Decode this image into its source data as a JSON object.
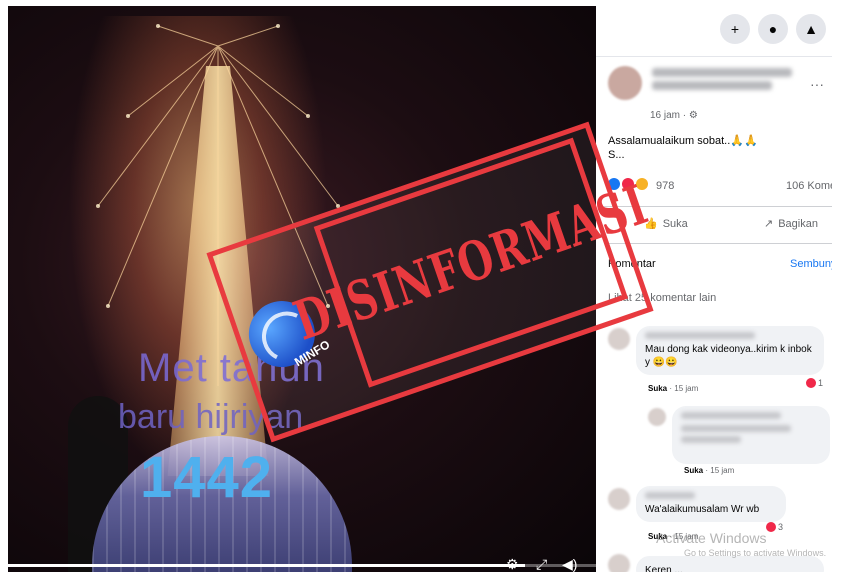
{
  "video": {
    "line1": "Met tahun",
    "line2": "baru hijriyan",
    "line3": "1442",
    "progress": 0.88
  },
  "stamp": {
    "label": "DISINFORMASI",
    "logo_text": "MINFO",
    "color": "#e83a3f"
  },
  "topbar": {
    "icons": [
      "plus-icon",
      "messenger-icon",
      "bell-icon"
    ],
    "glyphs": [
      "+",
      "●",
      "▲"
    ]
  },
  "post": {
    "time": "16 jam · ⚙",
    "text_line1": "Assalamualaikum sobat..🙏🙏",
    "text_line2": "S...",
    "reaction_count": "978",
    "comment_count": "106 Kome",
    "like_label": "Suka",
    "share_label": "Bagikan"
  },
  "comments_section": {
    "label": "Komentar",
    "link": "Sembunyi",
    "more": "Lihat 25 komentar lain"
  },
  "comments": [
    {
      "text": "Mau dong kak videonya..kirim k inbok y 😀😀",
      "meta_like": "Suka",
      "meta_time": "· 15 jam",
      "reacts": "1"
    },
    {
      "text": "",
      "meta_like": "Suka",
      "meta_time": "· 15 jam",
      "reacts": ""
    },
    {
      "text": "Wa'alaikumusalam Wr wb",
      "meta_like": "Suka",
      "meta_time": "· 15 jam",
      "reacts": "3"
    },
    {
      "text": "Keren ...",
      "meta_like": "",
      "meta_time": "",
      "reacts": ""
    }
  ],
  "watermark": {
    "line1": "Activate Windows",
    "line2": "Go to Settings to activate Windows."
  },
  "colors": {
    "fb_blue": "#1877f2",
    "stamp_red": "#e83a3f",
    "text_number": "#4fb0ee"
  }
}
